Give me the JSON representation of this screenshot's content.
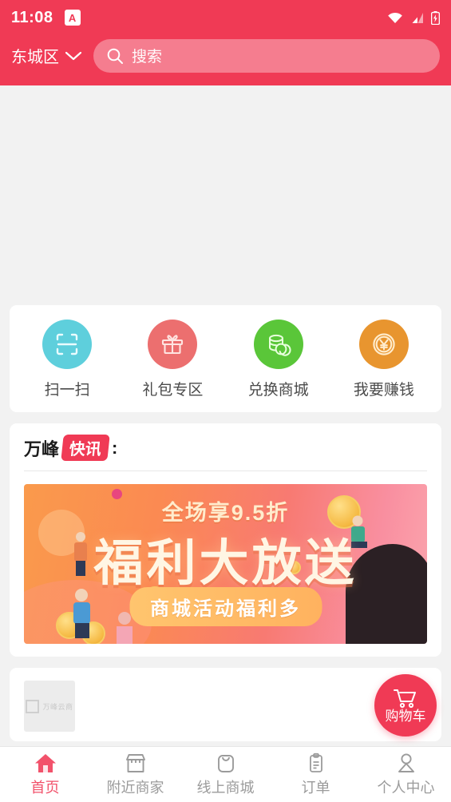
{
  "status_bar": {
    "time": "11:08",
    "app_badge": "A",
    "icons": [
      "wifi-icon",
      "signal-icon",
      "battery-charging-icon"
    ]
  },
  "header": {
    "location": "东城区",
    "location_chevron": "chevron-down-icon",
    "search_icon": "search-icon",
    "search_placeholder": "搜索",
    "search_value": ""
  },
  "quick_actions": [
    {
      "label": "扫一扫",
      "icon": "scan-icon",
      "color": "#5ecfdc"
    },
    {
      "label": "礼包专区",
      "icon": "gift-icon",
      "color": "#ec6f6f"
    },
    {
      "label": "兑换商城",
      "icon": "coins-icon",
      "color": "#5ac639"
    },
    {
      "label": "我要赚钱",
      "icon": "yen-coin-icon",
      "color": "#e8952f"
    }
  ],
  "news": {
    "brand": "万峰",
    "badge": "快讯",
    "colon": ":",
    "badge_color": "#f03a55"
  },
  "promo_banner": {
    "top_text": "全场享9.5折",
    "headline": "福利大放送",
    "pill_text": "商城活动福利多"
  },
  "bottom_card": {
    "thumbnail_watermark": "万峰云商",
    "thumbnail_icon": "image-placeholder-icon"
  },
  "floating_cart": {
    "icon": "shopping-cart-icon",
    "label": "购物车",
    "color": "#f03a55"
  },
  "tab_bar": {
    "active_index": 0,
    "active_color": "#f2526b",
    "inactive_color": "#9b9b9b",
    "items": [
      {
        "label": "首页",
        "icon": "home-icon"
      },
      {
        "label": "附近商家",
        "icon": "storefront-icon"
      },
      {
        "label": "线上商城",
        "icon": "shopping-bag-icon"
      },
      {
        "label": "订单",
        "icon": "clipboard-icon"
      },
      {
        "label": "个人中心",
        "icon": "person-icon"
      }
    ]
  },
  "theme": {
    "primary": "#f03a55",
    "page_background": "#f2f2f2",
    "card_background": "#ffffff"
  }
}
